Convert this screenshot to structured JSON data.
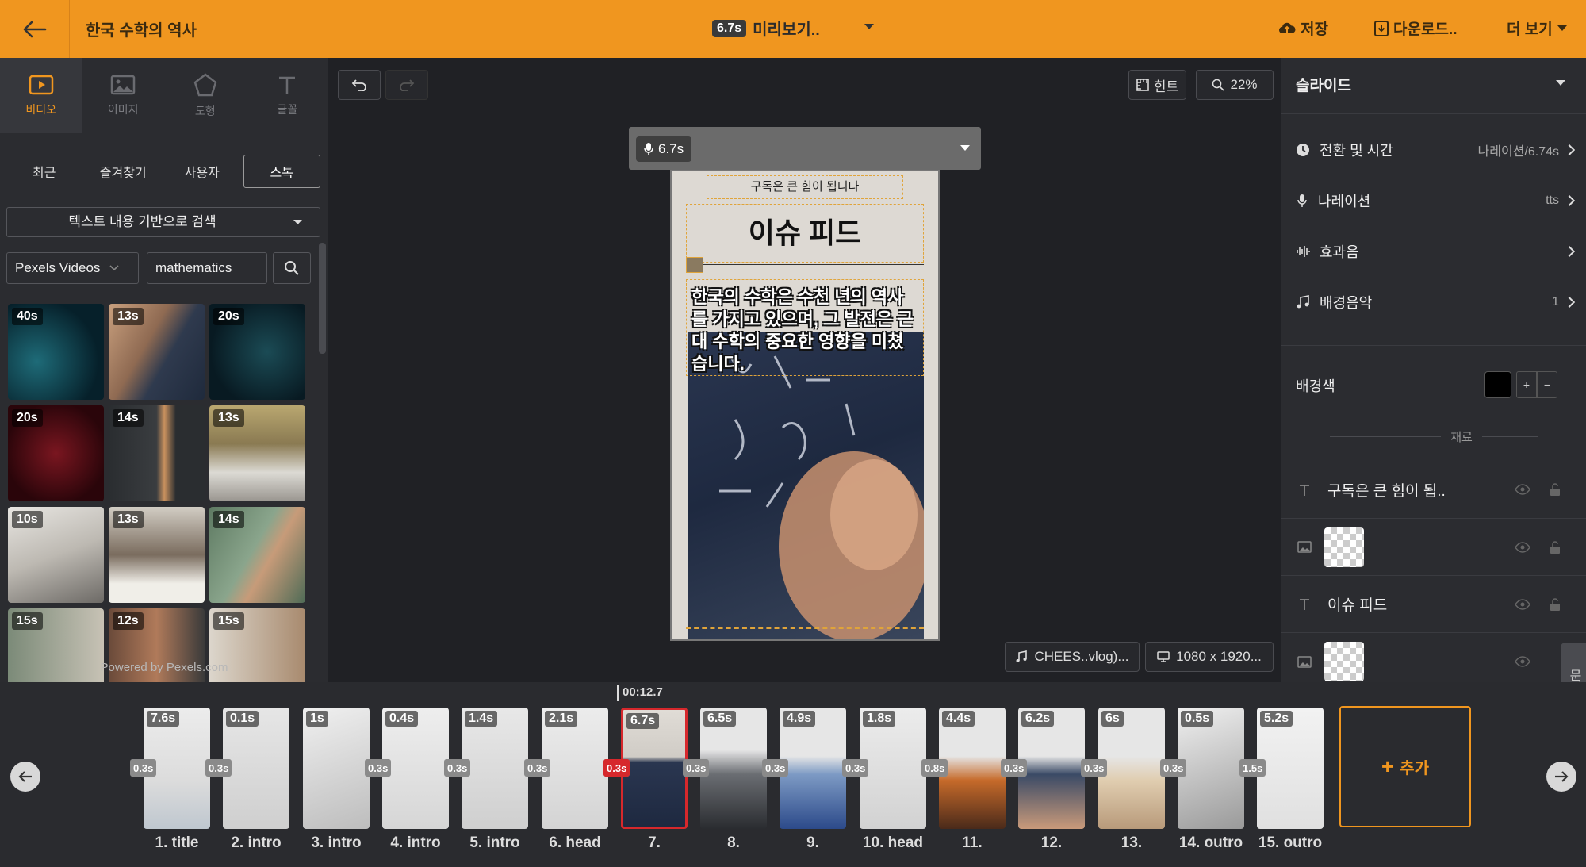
{
  "header": {
    "title": "한국 수학의 역사",
    "preview_duration": "6.7s",
    "preview_label": "미리보기..",
    "save_label": "저장",
    "download_label": "다운로드..",
    "more_label": "더 보기",
    "accent_color": "#F0961F"
  },
  "left": {
    "media_tabs": [
      {
        "label": "비디오",
        "icon": "video-icon",
        "active": true
      },
      {
        "label": "이미지",
        "icon": "image-icon",
        "active": false
      },
      {
        "label": "도형",
        "icon": "pentagon-icon",
        "active": false
      },
      {
        "label": "글꼴",
        "icon": "text-icon",
        "active": false
      }
    ],
    "source_tabs": [
      "최근",
      "즐겨찾기",
      "사용자",
      "스톡"
    ],
    "active_source_tab": "스톡",
    "search_mode": "텍스트 내용 기반으로 검색",
    "provider": "Pexels Videos",
    "query": "mathematics",
    "results": [
      "40s",
      "13s",
      "20s",
      "20s",
      "14s",
      "13s",
      "10s",
      "13s",
      "14s",
      "15s",
      "12s",
      "15s"
    ],
    "powered_by": "Powered by Pexels.com"
  },
  "canvas": {
    "hint_label": "힌트",
    "zoom": "22%",
    "narration_duration": "6.7s",
    "slide": {
      "top_text": "구독은 큰 힘이 됩니다",
      "heading": "이슈 피드",
      "body": "한국의 수학은 수천 년의 역사를 가지고 있으며, 그 발전은 근대 수학의 중요한 영향을 미쳤습니다."
    },
    "music_chip": "CHEES..vlog)...",
    "resolution_chip": "1080 x 1920..."
  },
  "right": {
    "section_title": "슬라이드",
    "rows": [
      {
        "label": "전환 및 시간",
        "icon": "clock-icon",
        "value": "나레이션/6.74s"
      },
      {
        "label": "나레이션",
        "icon": "mic-icon",
        "value": "tts"
      },
      {
        "label": "효과음",
        "icon": "waveform-icon",
        "value": ""
      },
      {
        "label": "배경음악",
        "icon": "music-icon",
        "value": "1"
      }
    ],
    "bg_color_label": "배경색",
    "bg_color": "#000000",
    "materials_label": "재료",
    "layers": [
      {
        "type": "text",
        "label": "구독은 큰 힘이 됩.."
      },
      {
        "type": "image",
        "label": ""
      },
      {
        "type": "text",
        "label": "이슈 피드"
      },
      {
        "type": "image",
        "label": ""
      }
    ]
  },
  "timeline": {
    "playhead_time": "00:12.7",
    "add_label": "추가",
    "side_tab_label": "문의",
    "clips": [
      {
        "duration": "7.6s",
        "label": "1. title",
        "transition": ""
      },
      {
        "duration": "0.1s",
        "label": "2. intro",
        "transition": "0.3s"
      },
      {
        "duration": "1s",
        "label": "3. intro",
        "transition": ""
      },
      {
        "duration": "0.4s",
        "label": "4. intro",
        "transition": "0.3s"
      },
      {
        "duration": "1.4s",
        "label": "5. intro",
        "transition": "0.3s"
      },
      {
        "duration": "2.1s",
        "label": "6. head",
        "transition": "0.3s"
      },
      {
        "duration": "6.7s",
        "label": "7.",
        "transition": "0.8s"
      },
      {
        "duration": "6.5s",
        "label": "8.",
        "transition": "0.3s"
      },
      {
        "duration": "4.9s",
        "label": "9.",
        "transition": "0.3s"
      },
      {
        "duration": "1.8s",
        "label": "10. head",
        "transition": "0.3s"
      },
      {
        "duration": "4.4s",
        "label": "11.",
        "transition": "0.8s"
      },
      {
        "duration": "6.2s",
        "label": "12.",
        "transition": "0.3s"
      },
      {
        "duration": "6s",
        "label": "13.",
        "transition": "0.3s"
      },
      {
        "duration": "0.5s",
        "label": "14. outro",
        "transition": "0.3s"
      },
      {
        "duration": "5.2s",
        "label": "15. outro",
        "transition": "1.5s"
      }
    ],
    "selected_transition": "0.3s"
  }
}
